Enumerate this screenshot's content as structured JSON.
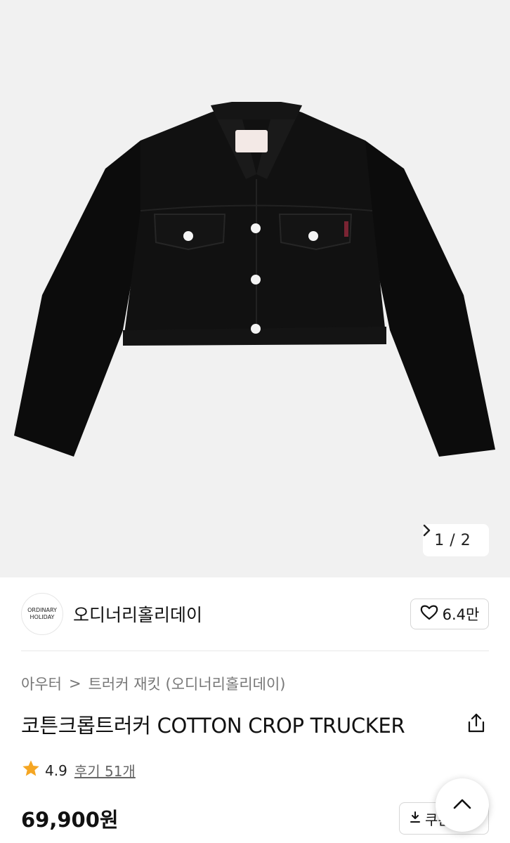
{
  "gallery": {
    "current": "1",
    "separator": "/",
    "total": "2",
    "next_icon": "chevron-right-icon",
    "image_description": "black cropped trucker jacket",
    "label_top": "ORDINARY",
    "label_bottom": "HOLIDAY"
  },
  "brand": {
    "logo_line1": "ORDINARY",
    "logo_line2": "HOLIDAY",
    "name": "오디너리홀리데이",
    "like_icon": "heart-icon",
    "like_count": "6.4만"
  },
  "breadcrumb": {
    "level1": "아우터",
    "separator": ">",
    "level2": "트러커 재킷 (오디너리홀리데이)"
  },
  "product": {
    "title": "코튼크롭트러커 COTTON CROP TRUCKER",
    "share_icon": "share-icon",
    "rating": "4.9",
    "review_label": "후기 51개",
    "price": "69,900원"
  },
  "actions": {
    "coupon_label": "쿠폰",
    "coupon_icon": "download-icon",
    "top_icon": "chevron-up-icon"
  },
  "colors": {
    "star": "#f5a623",
    "hero_bg": "#f1f1f1"
  }
}
